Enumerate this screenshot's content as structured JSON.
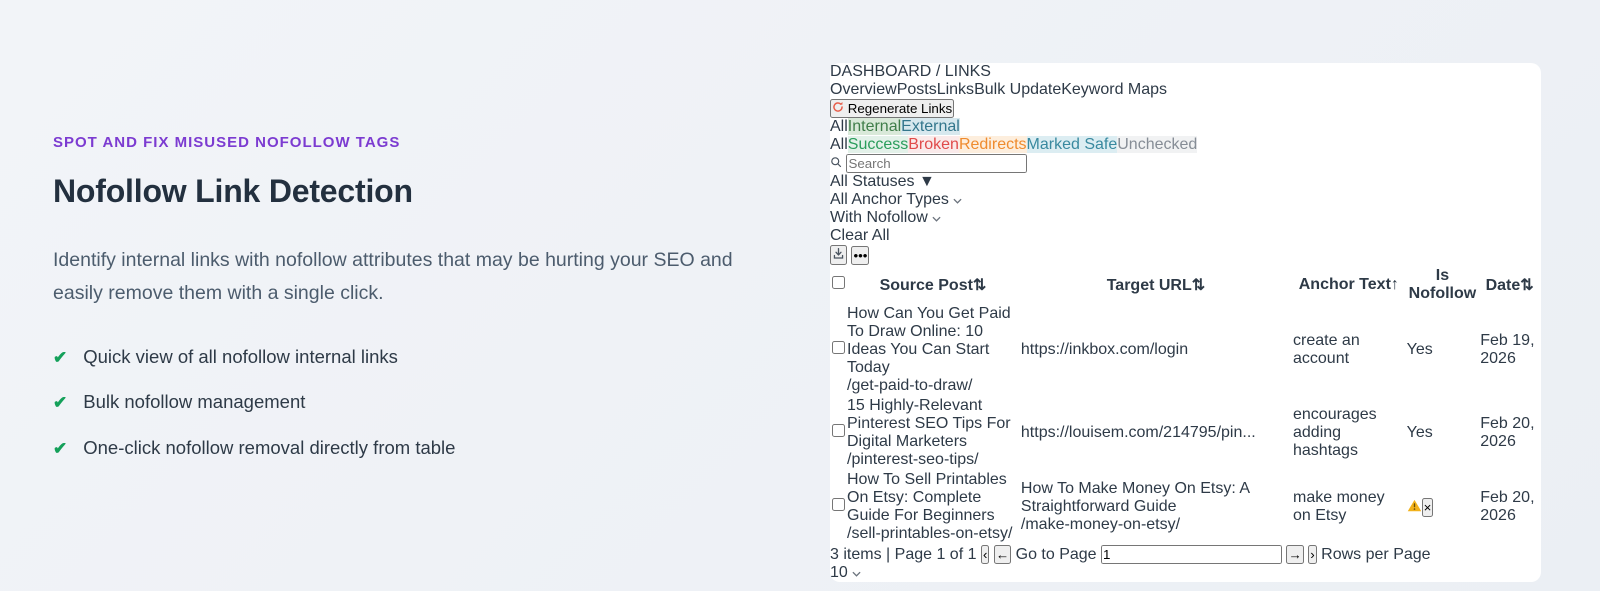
{
  "hero": {
    "eyebrow": "SPOT AND FIX MISUSED NOFOLLOW TAGS",
    "title": "Nofollow Link Detection",
    "description": "Identify internal links with nofollow attributes that may be hurting your SEO and easily remove them with a single click.",
    "check_glyph": "✔",
    "accent_color": "#7c3bd1",
    "check_color": "#14a05a",
    "features": [
      "Quick view of all nofollow internal links",
      "Bulk nofollow management",
      "One-click nofollow removal directly from table"
    ]
  },
  "dashboard": {
    "breadcrumb": {
      "root": "DASHBOARD",
      "separator": "/",
      "current": "LINKS"
    },
    "tabs": [
      {
        "label": "Overview",
        "active": false
      },
      {
        "label": "Posts",
        "active": false
      },
      {
        "label": "Links",
        "active": true
      },
      {
        "label": "Bulk Update",
        "active": false
      },
      {
        "label": "Keyword Maps",
        "active": false
      }
    ],
    "regenerate_label": "Regenerate Links",
    "regenerate_color": "#e8604c",
    "scope_filter": [
      {
        "label": "All",
        "active": true,
        "bg": "#ffffff",
        "color": "#28303d"
      },
      {
        "label": "Internal",
        "active": false,
        "bg": "#d9e9d9",
        "color": "#3f7d49"
      },
      {
        "label": "External",
        "active": false,
        "bg": "#d7e8ee",
        "color": "#33768c"
      }
    ],
    "status_filter": [
      {
        "label": "All",
        "active": true,
        "bg": "#ffffff",
        "color": "#28303d"
      },
      {
        "label": "Success",
        "active": false,
        "bg": "#e3f1e9",
        "color": "#2a9d5c"
      },
      {
        "label": "Broken",
        "active": false,
        "bg": "#faeaea",
        "color": "#e04b4b"
      },
      {
        "label": "Redirects",
        "active": false,
        "bg": "#fdeedd",
        "color": "#ef8b2e"
      },
      {
        "label": "Marked Safe",
        "active": false,
        "bg": "#dcedf2",
        "color": "#39899f"
      },
      {
        "label": "Unchecked",
        "active": false,
        "bg": "#f1f2f3",
        "color": "#868d96"
      }
    ],
    "toolbar": {
      "search_placeholder": "Search",
      "statuses_value": "All Statuses",
      "anchor_types_value": "All Anchor Types",
      "nofollow_value": "With Nofollow",
      "clear_all": "Clear All",
      "more_glyph": "•••"
    },
    "table": {
      "columns": [
        {
          "label": "Source Post",
          "sort": "both"
        },
        {
          "label": "Target URL",
          "sort": "both"
        },
        {
          "label": "Anchor Text",
          "sort": "asc"
        },
        {
          "label": "Is Nofollow",
          "sort": "none"
        },
        {
          "label": "Date",
          "sort": "both"
        }
      ],
      "sort_glyphs": {
        "both": "⇅",
        "asc": "↑"
      },
      "rows": [
        {
          "source_title": "How Can You Get Paid To Draw Online: 10 Ideas You Can Start Today",
          "source_slug": "/get-paid-to-draw/",
          "target_text": "https://inkbox.com/login",
          "target_slug": "",
          "anchor_text": "create an account",
          "is_nofollow": "Yes",
          "warning": false,
          "date": "Feb 19, 2026"
        },
        {
          "source_title": "15 Highly-Relevant Pinterest SEO Tips For Digital Marketers",
          "source_slug": "/pinterest-seo-tips/",
          "target_text": "https://louisem.com/214795/pin...",
          "target_slug": "",
          "anchor_text": "encourages adding hashtags",
          "is_nofollow": "Yes",
          "warning": false,
          "date": "Feb 20, 2026"
        },
        {
          "source_title": "How To Sell Printables On Etsy: Complete Guide For Beginners",
          "source_slug": "/sell-printables-on-etsy/",
          "target_text": "How To Make Money On Etsy: A Straightforward Guide",
          "target_slug": "/make-money-on-etsy/",
          "anchor_text": "make money on Etsy",
          "is_nofollow": "",
          "warning": true,
          "date": "Feb 20, 2026"
        }
      ]
    },
    "pagination": {
      "items_text": "3 items",
      "page_text": "Page 1 of 1",
      "prev_fast_glyph": "‹",
      "prev_glyph": "←",
      "go_to_page_label": "Go to Page",
      "page_input": "1",
      "next_glyph": "→",
      "next_fast_glyph": "›",
      "rows_per_page_label": "Rows per Page",
      "rows_per_page_value": "10"
    }
  }
}
